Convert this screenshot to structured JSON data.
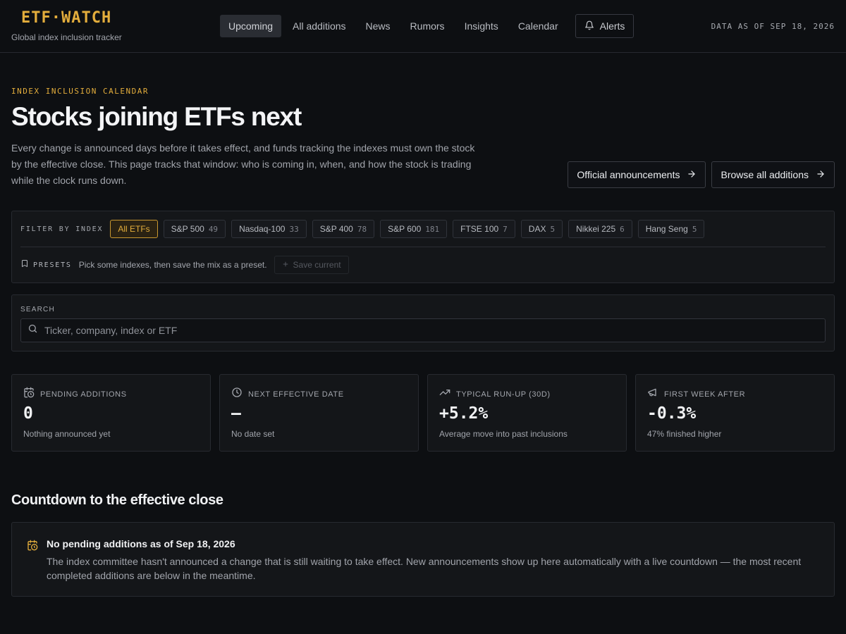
{
  "brand": {
    "logo": "ETF·WATCH",
    "tagline": "Global index inclusion tracker"
  },
  "nav": {
    "items": [
      {
        "label": "Upcoming",
        "active": true
      },
      {
        "label": "All additions"
      },
      {
        "label": "News"
      },
      {
        "label": "Rumors"
      },
      {
        "label": "Insights"
      },
      {
        "label": "Calendar"
      }
    ],
    "alerts_label": "Alerts",
    "data_as_of": "DATA AS OF SEP 18, 2026"
  },
  "hero": {
    "eyebrow": "INDEX INCLUSION CALENDAR",
    "title": "Stocks joining ETFs next",
    "description": "Every change is announced days before it takes effect, and funds tracking the indexes must own the stock by the effective close. This page tracks that window: who is coming in, when, and how the stock is trading while the clock runs down.",
    "buttons": {
      "official": "Official announcements",
      "browse": "Browse all additions"
    }
  },
  "filter": {
    "label": "FILTER BY INDEX",
    "chips": [
      {
        "label": "All ETFs",
        "count": "",
        "active": true
      },
      {
        "label": "S&P 500",
        "count": "49"
      },
      {
        "label": "Nasdaq-100",
        "count": "33"
      },
      {
        "label": "S&P 400",
        "count": "78"
      },
      {
        "label": "S&P 600",
        "count": "181"
      },
      {
        "label": "FTSE 100",
        "count": "7"
      },
      {
        "label": "DAX",
        "count": "5"
      },
      {
        "label": "Nikkei 225",
        "count": "6"
      },
      {
        "label": "Hang Seng",
        "count": "5"
      }
    ],
    "presets": {
      "label": "PRESETS",
      "hint": "Pick some indexes, then save the mix as a preset.",
      "save_label": "Save current"
    }
  },
  "search": {
    "label": "SEARCH",
    "placeholder": "Ticker, company, index or ETF"
  },
  "stats": [
    {
      "icon": "calendar-clock-icon",
      "label": "PENDING ADDITIONS",
      "value": "0",
      "sub": "Nothing announced yet"
    },
    {
      "icon": "clock-icon",
      "label": "NEXT EFFECTIVE DATE",
      "value": "—",
      "sub": "No date set"
    },
    {
      "icon": "trending-up-icon",
      "label": "TYPICAL RUN-UP (30D)",
      "value": "+5.2%",
      "sub": "Average move into past inclusions"
    },
    {
      "icon": "megaphone-icon",
      "label": "FIRST WEEK AFTER",
      "value": "-0.3%",
      "sub": "47% finished higher"
    }
  ],
  "countdown": {
    "title": "Countdown to the effective close",
    "empty_title": "No pending additions as of Sep 18, 2026",
    "empty_text": "The index committee hasn't announced a change that is still waiting to take effect. New announcements show up here automatically with a live countdown — the most recent completed additions are below in the meantime."
  },
  "colors": {
    "accent": "#e3ad3c",
    "background": "#0d0f12",
    "panel": "#141619"
  }
}
